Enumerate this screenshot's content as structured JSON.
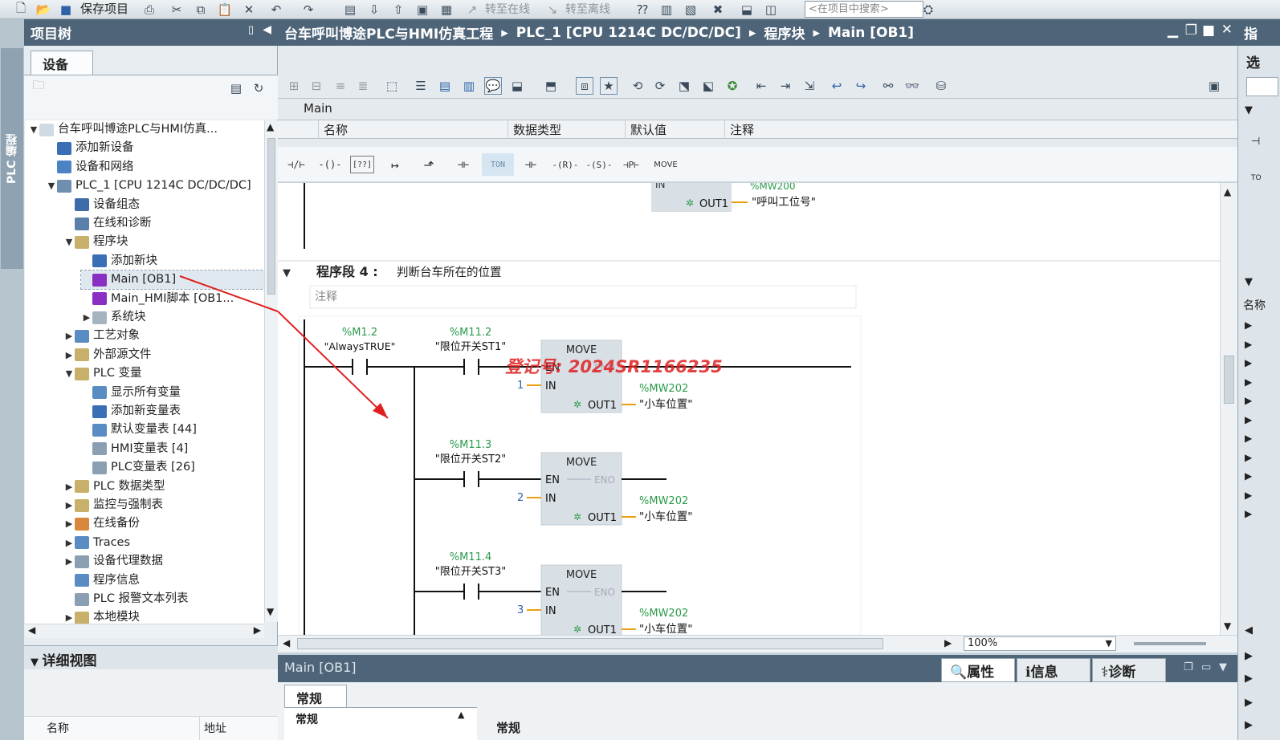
{
  "toolbar": {
    "save_label": "保存项目",
    "go_online": "转至在线",
    "go_offline": "转至离线",
    "search_placeholder": "<在项目中搜索>"
  },
  "left_strip": {
    "label": "PLC 编程"
  },
  "project_tree": {
    "title": "项目树",
    "tab": "设备",
    "items": [
      {
        "label": "台车呼叫博途PLC与HMI仿真...",
        "arrow": "▼",
        "indent": 0,
        "icon": "#d0dae3"
      },
      {
        "label": "添加新设备",
        "arrow": "",
        "indent": 1,
        "icon": "#3b6fb5"
      },
      {
        "label": "设备和网络",
        "arrow": "",
        "indent": 1,
        "icon": "#4c83c4"
      },
      {
        "label": "PLC_1 [CPU 1214C DC/DC/DC]",
        "arrow": "▼",
        "indent": 1,
        "icon": "#6f8fae"
      },
      {
        "label": "设备组态",
        "arrow": "",
        "indent": 2,
        "icon": "#3d6ca8"
      },
      {
        "label": "在线和诊断",
        "arrow": "",
        "indent": 2,
        "icon": "#5a7fa8"
      },
      {
        "label": "程序块",
        "arrow": "▼",
        "indent": 2,
        "icon": "#c9b06a"
      },
      {
        "label": "添加新块",
        "arrow": "",
        "indent": 3,
        "icon": "#3b6fb5"
      },
      {
        "label": "Main [OB1]",
        "arrow": "",
        "indent": 3,
        "icon": "#8a2fc4"
      },
      {
        "label": "Main_HMI脚本 [OB1...",
        "arrow": "",
        "indent": 3,
        "icon": "#8a2fc4"
      },
      {
        "label": "系统块",
        "arrow": "▶",
        "indent": 3,
        "icon": "#a6b4c0"
      },
      {
        "label": "工艺对象",
        "arrow": "▶",
        "indent": 2,
        "icon": "#5a8cc4"
      },
      {
        "label": "外部源文件",
        "arrow": "▶",
        "indent": 2,
        "icon": "#c9b06a"
      },
      {
        "label": "PLC 变量",
        "arrow": "▼",
        "indent": 2,
        "icon": "#c9b06a"
      },
      {
        "label": "显示所有变量",
        "arrow": "",
        "indent": 3,
        "icon": "#5a8cc4"
      },
      {
        "label": "添加新变量表",
        "arrow": "",
        "indent": 3,
        "icon": "#3b6fb5"
      },
      {
        "label": "默认变量表 [44]",
        "arrow": "",
        "indent": 3,
        "icon": "#5a8cc4"
      },
      {
        "label": "HMI变量表 [4]",
        "arrow": "",
        "indent": 3,
        "icon": "#8aa0b2"
      },
      {
        "label": "PLC变量表 [26]",
        "arrow": "",
        "indent": 3,
        "icon": "#8aa0b2"
      },
      {
        "label": "PLC 数据类型",
        "arrow": "▶",
        "indent": 2,
        "icon": "#c9b06a"
      },
      {
        "label": "监控与强制表",
        "arrow": "▶",
        "indent": 2,
        "icon": "#c9b06a"
      },
      {
        "label": "在线备份",
        "arrow": "▶",
        "indent": 2,
        "icon": "#d9873a"
      },
      {
        "label": "Traces",
        "arrow": "▶",
        "indent": 2,
        "icon": "#5a8cc4"
      },
      {
        "label": "设备代理数据",
        "arrow": "▶",
        "indent": 2,
        "icon": "#8aa0b2"
      },
      {
        "label": "程序信息",
        "arrow": "",
        "indent": 2,
        "icon": "#5a8cc4"
      },
      {
        "label": "PLC 报警文本列表",
        "arrow": "",
        "indent": 2,
        "icon": "#8aa0b2"
      },
      {
        "label": "本地模块",
        "arrow": "▶",
        "indent": 2,
        "icon": "#c9b06a"
      }
    ],
    "selected_index": 8
  },
  "detail_view": {
    "title": "详细视图",
    "col_name": "名称",
    "col_address": "地址"
  },
  "editor": {
    "breadcrumb": [
      "台车呼叫博途PLC与HMI仿真工程",
      "PLC_1 [CPU 1214C DC/DC/DC]",
      "程序块",
      "Main [OB1]"
    ],
    "interface_title": "Main",
    "interface_cols": [
      "名称",
      "数据类型",
      "默认值",
      "注释"
    ],
    "ladder_buttons": [
      "⊣/⊢",
      "-()-",
      "[??]",
      "↦",
      "⬏",
      "⊣⊢",
      "TON",
      "⊣⊢",
      "-(R)-",
      "-(S)-",
      "⊣P⊢",
      "MOVE"
    ],
    "top_partial": {
      "out_label": "OUT1",
      "address": "%MW200",
      "tag": "\"呼叫工位号\""
    },
    "network": {
      "title": "程序段 4 :",
      "description": "判断台车所在的位置",
      "comment": "注释",
      "contact1": {
        "address": "%M1.2",
        "tag": "\"AlwaysTRUE\""
      },
      "branches": [
        {
          "address": "%M11.2",
          "tag": "\"限位开关ST1\"",
          "in": "1",
          "out_address": "%MW202",
          "out_tag": "\"小车位置\""
        },
        {
          "address": "%M11.3",
          "tag": "\"限位开关ST2\"",
          "in": "2",
          "out_address": "%MW202",
          "out_tag": "\"小车位置\""
        },
        {
          "address": "%M11.4",
          "tag": "\"限位开关ST3\"",
          "in": "3",
          "out_address": "%MW202",
          "out_tag": "\"小车位置\""
        }
      ],
      "box": {
        "title": "MOVE",
        "en": "EN",
        "eno": "ENO",
        "in": "IN",
        "out": "OUT1"
      },
      "watermark": "登记号: 2024SR1166235"
    },
    "zoom": "100%"
  },
  "properties": {
    "title": "Main [OB1]",
    "tabs": [
      "属性",
      "信息",
      "诊断"
    ],
    "subtab": "常规",
    "left_item": "常规",
    "right_title": "常规"
  },
  "right_panel": {
    "title": "指",
    "label1": "选",
    "label2": "名称"
  },
  "colors": {
    "header": "#4e6478",
    "accent_red": "#e02020",
    "address_green": "#2a9a4a",
    "wire": "#111111",
    "in_orange": "#e8a010"
  }
}
